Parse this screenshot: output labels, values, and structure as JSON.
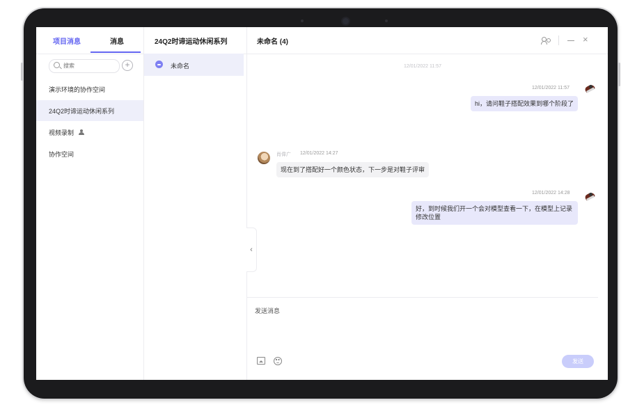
{
  "sidebar": {
    "tabs": [
      {
        "label": "项目消息",
        "active": true
      },
      {
        "label": "消息",
        "active": false
      }
    ],
    "search": {
      "placeholder": "搜索"
    },
    "add_label": "+",
    "projects": [
      {
        "label": "演示环境的协作空间",
        "active": false
      },
      {
        "label": "24Q2时谛运动休闲系列",
        "active": true
      },
      {
        "label": "视频录制",
        "active": false,
        "icon": "person-icon"
      },
      {
        "label": "协作空间",
        "active": false
      }
    ]
  },
  "middle": {
    "title": "24Q2时谛运动休闲系列",
    "chats": [
      {
        "name": "未命名",
        "icon": "chat-icon"
      }
    ],
    "collapse_icon": "‹"
  },
  "chat": {
    "title": "未命名 (4)",
    "header_icons": [
      "members-icon",
      "minimize-icon",
      "close-icon"
    ],
    "close_glyph": "×",
    "center_timestamp": "12/01/2022 11:57",
    "messages": [
      {
        "side": "me",
        "time": "12/01/2022 11:57",
        "text": "hi，请问鞋子搭配效果到哪个阶段了"
      },
      {
        "side": "other",
        "sender": "肖偉广",
        "time": "12/01/2022 14:27",
        "text": "现在到了搭配好一个颜色状态，下一步是对鞋子评审"
      },
      {
        "side": "me",
        "time": "12/01/2022 14:28",
        "text": "好，到时候我们开一个会对模型查看一下，在模型上记录修改位置"
      }
    ],
    "input_placeholder": "发送消息",
    "send_label": "发送"
  },
  "colors": {
    "accent": "#6466f1",
    "bubble_me": "#e8e8fb",
    "bubble_other": "#f2f2f4",
    "active_row": "#eeeffa",
    "send_disabled": "#c9cdfb",
    "bezel": "#1b1b1d"
  }
}
